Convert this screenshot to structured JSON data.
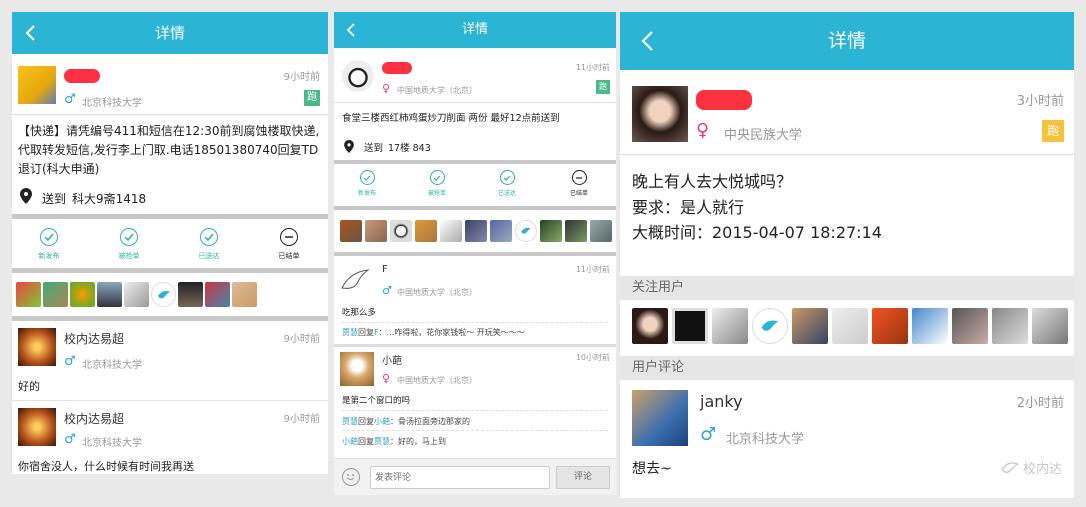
{
  "header": {
    "title": "详情"
  },
  "p1": {
    "time": "9小时前",
    "school": "北京科技大学",
    "badge": "跑",
    "content": "【快递】请凭编号411和短信在12:30前到腐蚀楼取快递,代取转发短信,发行李上门取.电话18501380740回复TD退订(科大申通)",
    "dest_label": "送到",
    "dest": "科大9斋1418",
    "status": [
      "新发布",
      "被抢单",
      "已送达",
      "已结单"
    ],
    "comments": [
      {
        "name": "校内达易超",
        "time": "9小时前",
        "school": "北京科技大学",
        "text": "好的"
      },
      {
        "name": "校内达易超",
        "time": "9小时前",
        "school": "北京科技大学",
        "text": "你宿舍没人，什么时候有时间我再送"
      }
    ]
  },
  "p2": {
    "time": "11小时前",
    "school": "中国地质大学（北京）",
    "badge": "跑",
    "content": "食堂三楼西红柿鸡蛋炒刀削面 两份 最好12点前送到",
    "dest_label": "送到",
    "dest": "17楼 843",
    "status": [
      "新发布",
      "被抢单",
      "已送达",
      "已结单"
    ],
    "comments": [
      {
        "name": "F",
        "time": "11小时前",
        "school": "中国地质大学（北京）",
        "text": "吃那么多",
        "replies": [
          {
            "from": "贾慧",
            "reply_word": "回复",
            "to": "F",
            "text": "：...咋得啦，花你家钱啦～ 开玩笑～～～"
          }
        ]
      },
      {
        "name": "小葩",
        "time": "10小时前",
        "school": "中国地质大学（北京）",
        "text": "是第二个窗口的吗",
        "replies": [
          {
            "from": "贾慧",
            "reply_word": "回复",
            "to": "小葩",
            "text": "：骨汤拉面旁边那家的"
          },
          {
            "from": "小葩",
            "reply_word": "回复",
            "to": "贾慧",
            "text": "：好的，马上到"
          }
        ]
      }
    ],
    "input_placeholder": "发表评论",
    "send_label": "评论"
  },
  "p3": {
    "time": "3小时前",
    "school": "中央民族大学",
    "badge": "跑",
    "content": [
      "晚上有人去大悦城吗？",
      "要求：是人就行",
      "大概时间：2015-04-07 18:27:14"
    ],
    "follow_title": "关注用户",
    "comment_title": "用户评论",
    "comment": {
      "name": "janky",
      "time": "2小时前",
      "school": "北京科技大学",
      "text": "想去~"
    },
    "watermark": "校内达"
  },
  "colors": {
    "accent": "#2bb4d4",
    "male": "#2aa6c8",
    "female": "#e23a86"
  }
}
